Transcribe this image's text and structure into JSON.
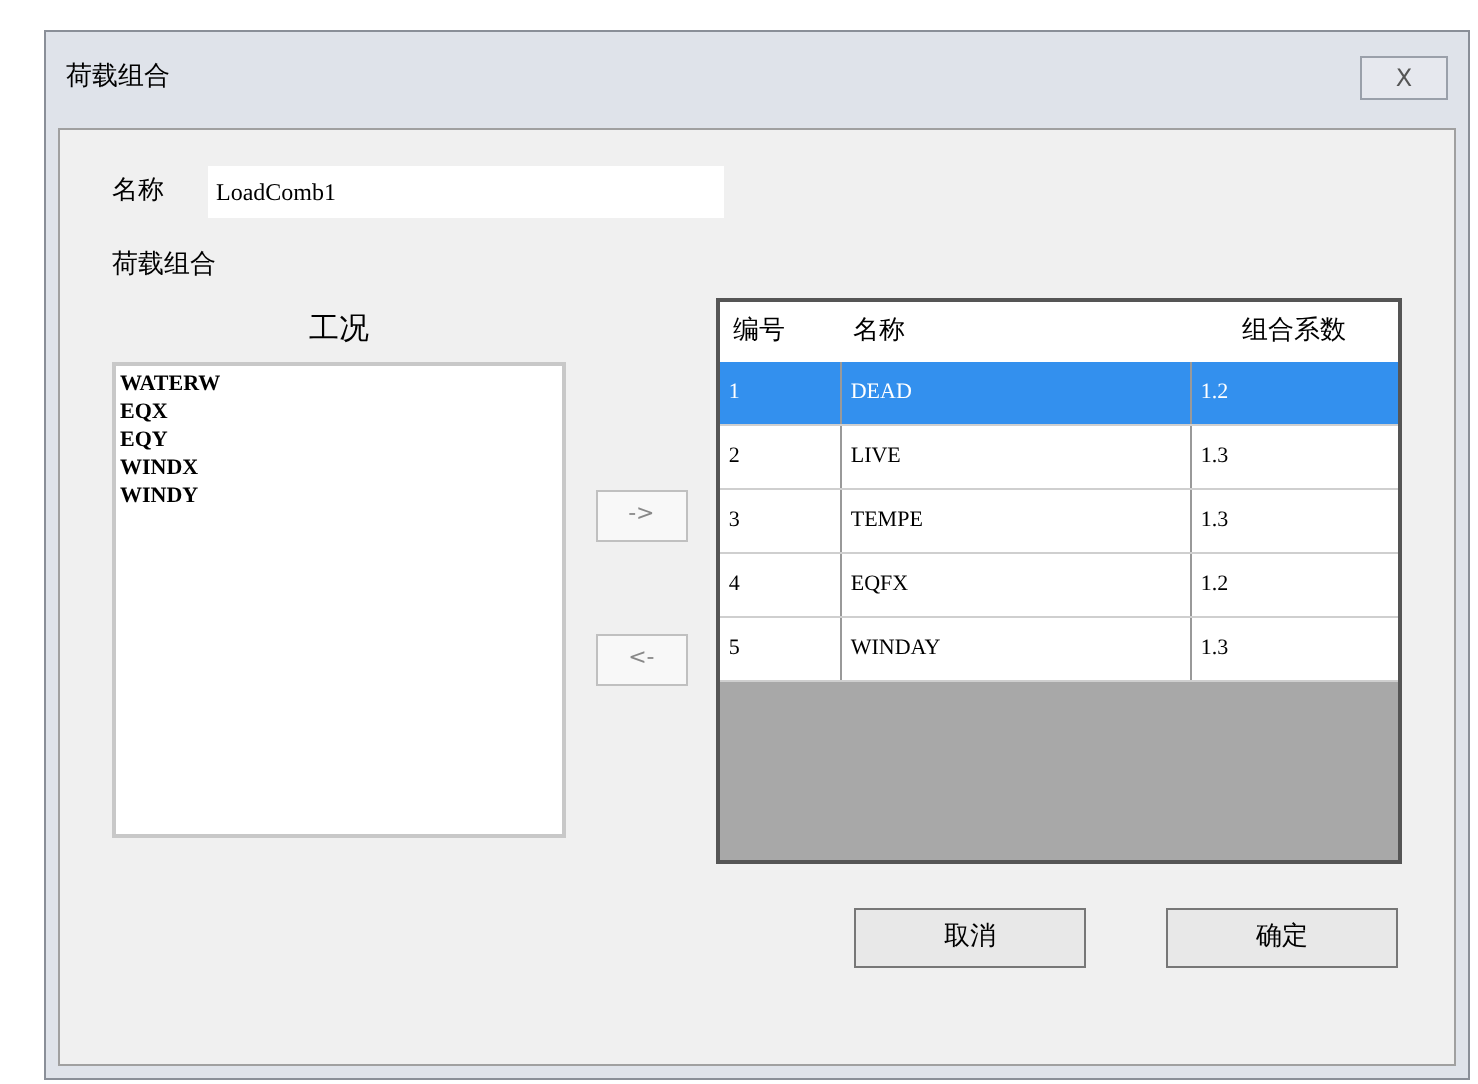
{
  "window": {
    "title": "荷载组合",
    "close_label": "X"
  },
  "name_field": {
    "label": "名称",
    "value": "LoadComb1"
  },
  "section_label": "荷载组合",
  "load_cases": {
    "title": "工况",
    "items": [
      "WATERW",
      "EQX",
      "EQY",
      "WINDX",
      "WINDY"
    ]
  },
  "move_buttons": [
    "->",
    "<-"
  ],
  "table": {
    "columns": [
      "编号",
      "名称",
      "组合系数"
    ],
    "rows": [
      {
        "cells": [
          "1",
          "DEAD",
          "1.2"
        ],
        "selected": true
      },
      {
        "cells": [
          "2",
          "LIVE",
          "1.3"
        ],
        "selected": false
      },
      {
        "cells": [
          "3",
          "TEMPE",
          "1.3"
        ],
        "selected": false
      },
      {
        "cells": [
          "4",
          "EQFX",
          "1.2"
        ],
        "selected": false
      },
      {
        "cells": [
          "5",
          "WINDAY",
          "1.3"
        ],
        "selected": false
      }
    ]
  },
  "buttons": [
    "取消",
    "确定"
  ]
}
